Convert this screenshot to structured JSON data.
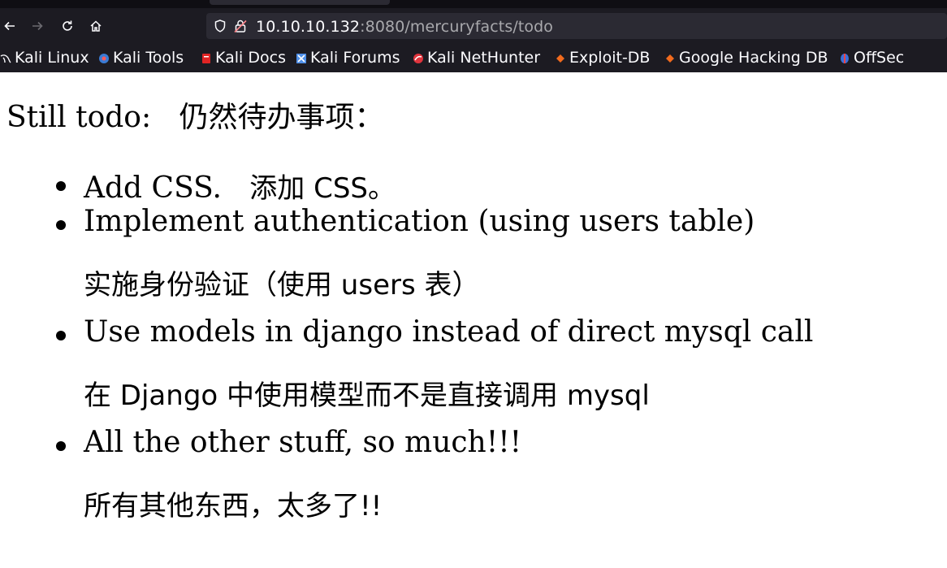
{
  "browser": {
    "url": {
      "host": "10.10.10.132",
      "path": ":8080/mercuryfacts/todo"
    },
    "bookmarks": [
      {
        "label": "Kali Linux",
        "icon": "kali-dragon-icon"
      },
      {
        "label": "Kali Tools",
        "icon": "kali-tools-icon"
      },
      {
        "label": "Kali Docs",
        "icon": "kali-docs-icon"
      },
      {
        "label": "Kali Forums",
        "icon": "kali-forums-icon"
      },
      {
        "label": "Kali NetHunter",
        "icon": "kali-nethunter-icon"
      },
      {
        "label": "Exploit-DB",
        "icon": "exploit-db-icon"
      },
      {
        "label": "Google Hacking DB",
        "icon": "ghdb-icon"
      },
      {
        "label": "OffSec",
        "icon": "offsec-icon"
      }
    ]
  },
  "page": {
    "heading_en": "Still todo:",
    "heading_zh": "仍然待办事项：",
    "items": [
      {
        "en": "Add CSS.",
        "zh": "添加 CSS。"
      },
      {
        "en": "Implement authentication (using users table)",
        "zh": "实施身份验证（使用 users 表）"
      },
      {
        "en": "Use models in django instead of direct mysql call",
        "zh": "在 Django 中使用模型而不是直接调用 mysql"
      },
      {
        "en": "All the other stuff, so much!!!",
        "zh": "所有其他东西，太多了!!"
      }
    ]
  }
}
